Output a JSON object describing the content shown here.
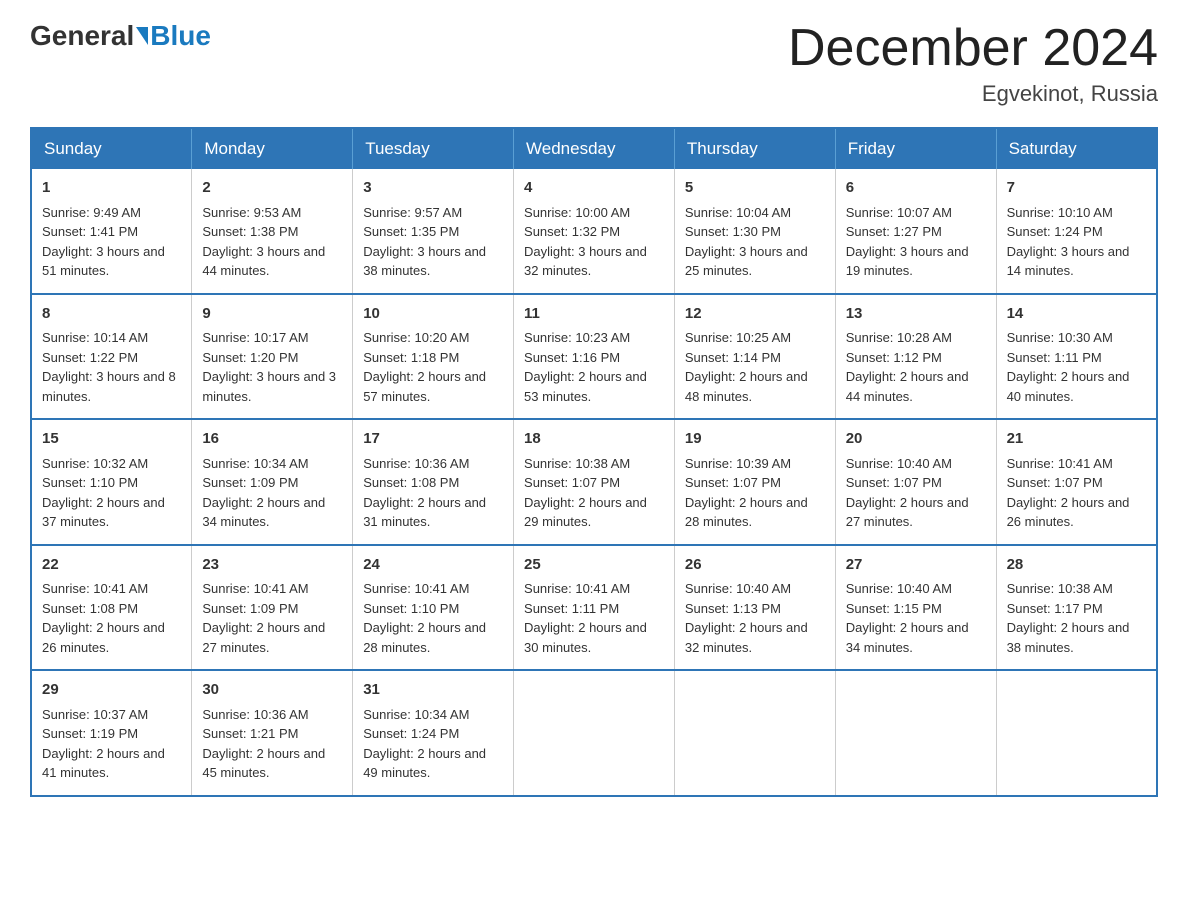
{
  "header": {
    "logo_general": "General",
    "logo_blue": "Blue",
    "month_title": "December 2024",
    "location": "Egvekinot, Russia"
  },
  "weekdays": [
    "Sunday",
    "Monday",
    "Tuesday",
    "Wednesday",
    "Thursday",
    "Friday",
    "Saturday"
  ],
  "weeks": [
    [
      {
        "day": "1",
        "sunrise": "Sunrise: 9:49 AM",
        "sunset": "Sunset: 1:41 PM",
        "daylight": "Daylight: 3 hours and 51 minutes."
      },
      {
        "day": "2",
        "sunrise": "Sunrise: 9:53 AM",
        "sunset": "Sunset: 1:38 PM",
        "daylight": "Daylight: 3 hours and 44 minutes."
      },
      {
        "day": "3",
        "sunrise": "Sunrise: 9:57 AM",
        "sunset": "Sunset: 1:35 PM",
        "daylight": "Daylight: 3 hours and 38 minutes."
      },
      {
        "day": "4",
        "sunrise": "Sunrise: 10:00 AM",
        "sunset": "Sunset: 1:32 PM",
        "daylight": "Daylight: 3 hours and 32 minutes."
      },
      {
        "day": "5",
        "sunrise": "Sunrise: 10:04 AM",
        "sunset": "Sunset: 1:30 PM",
        "daylight": "Daylight: 3 hours and 25 minutes."
      },
      {
        "day": "6",
        "sunrise": "Sunrise: 10:07 AM",
        "sunset": "Sunset: 1:27 PM",
        "daylight": "Daylight: 3 hours and 19 minutes."
      },
      {
        "day": "7",
        "sunrise": "Sunrise: 10:10 AM",
        "sunset": "Sunset: 1:24 PM",
        "daylight": "Daylight: 3 hours and 14 minutes."
      }
    ],
    [
      {
        "day": "8",
        "sunrise": "Sunrise: 10:14 AM",
        "sunset": "Sunset: 1:22 PM",
        "daylight": "Daylight: 3 hours and 8 minutes."
      },
      {
        "day": "9",
        "sunrise": "Sunrise: 10:17 AM",
        "sunset": "Sunset: 1:20 PM",
        "daylight": "Daylight: 3 hours and 3 minutes."
      },
      {
        "day": "10",
        "sunrise": "Sunrise: 10:20 AM",
        "sunset": "Sunset: 1:18 PM",
        "daylight": "Daylight: 2 hours and 57 minutes."
      },
      {
        "day": "11",
        "sunrise": "Sunrise: 10:23 AM",
        "sunset": "Sunset: 1:16 PM",
        "daylight": "Daylight: 2 hours and 53 minutes."
      },
      {
        "day": "12",
        "sunrise": "Sunrise: 10:25 AM",
        "sunset": "Sunset: 1:14 PM",
        "daylight": "Daylight: 2 hours and 48 minutes."
      },
      {
        "day": "13",
        "sunrise": "Sunrise: 10:28 AM",
        "sunset": "Sunset: 1:12 PM",
        "daylight": "Daylight: 2 hours and 44 minutes."
      },
      {
        "day": "14",
        "sunrise": "Sunrise: 10:30 AM",
        "sunset": "Sunset: 1:11 PM",
        "daylight": "Daylight: 2 hours and 40 minutes."
      }
    ],
    [
      {
        "day": "15",
        "sunrise": "Sunrise: 10:32 AM",
        "sunset": "Sunset: 1:10 PM",
        "daylight": "Daylight: 2 hours and 37 minutes."
      },
      {
        "day": "16",
        "sunrise": "Sunrise: 10:34 AM",
        "sunset": "Sunset: 1:09 PM",
        "daylight": "Daylight: 2 hours and 34 minutes."
      },
      {
        "day": "17",
        "sunrise": "Sunrise: 10:36 AM",
        "sunset": "Sunset: 1:08 PM",
        "daylight": "Daylight: 2 hours and 31 minutes."
      },
      {
        "day": "18",
        "sunrise": "Sunrise: 10:38 AM",
        "sunset": "Sunset: 1:07 PM",
        "daylight": "Daylight: 2 hours and 29 minutes."
      },
      {
        "day": "19",
        "sunrise": "Sunrise: 10:39 AM",
        "sunset": "Sunset: 1:07 PM",
        "daylight": "Daylight: 2 hours and 28 minutes."
      },
      {
        "day": "20",
        "sunrise": "Sunrise: 10:40 AM",
        "sunset": "Sunset: 1:07 PM",
        "daylight": "Daylight: 2 hours and 27 minutes."
      },
      {
        "day": "21",
        "sunrise": "Sunrise: 10:41 AM",
        "sunset": "Sunset: 1:07 PM",
        "daylight": "Daylight: 2 hours and 26 minutes."
      }
    ],
    [
      {
        "day": "22",
        "sunrise": "Sunrise: 10:41 AM",
        "sunset": "Sunset: 1:08 PM",
        "daylight": "Daylight: 2 hours and 26 minutes."
      },
      {
        "day": "23",
        "sunrise": "Sunrise: 10:41 AM",
        "sunset": "Sunset: 1:09 PM",
        "daylight": "Daylight: 2 hours and 27 minutes."
      },
      {
        "day": "24",
        "sunrise": "Sunrise: 10:41 AM",
        "sunset": "Sunset: 1:10 PM",
        "daylight": "Daylight: 2 hours and 28 minutes."
      },
      {
        "day": "25",
        "sunrise": "Sunrise: 10:41 AM",
        "sunset": "Sunset: 1:11 PM",
        "daylight": "Daylight: 2 hours and 30 minutes."
      },
      {
        "day": "26",
        "sunrise": "Sunrise: 10:40 AM",
        "sunset": "Sunset: 1:13 PM",
        "daylight": "Daylight: 2 hours and 32 minutes."
      },
      {
        "day": "27",
        "sunrise": "Sunrise: 10:40 AM",
        "sunset": "Sunset: 1:15 PM",
        "daylight": "Daylight: 2 hours and 34 minutes."
      },
      {
        "day": "28",
        "sunrise": "Sunrise: 10:38 AM",
        "sunset": "Sunset: 1:17 PM",
        "daylight": "Daylight: 2 hours and 38 minutes."
      }
    ],
    [
      {
        "day": "29",
        "sunrise": "Sunrise: 10:37 AM",
        "sunset": "Sunset: 1:19 PM",
        "daylight": "Daylight: 2 hours and 41 minutes."
      },
      {
        "day": "30",
        "sunrise": "Sunrise: 10:36 AM",
        "sunset": "Sunset: 1:21 PM",
        "daylight": "Daylight: 2 hours and 45 minutes."
      },
      {
        "day": "31",
        "sunrise": "Sunrise: 10:34 AM",
        "sunset": "Sunset: 1:24 PM",
        "daylight": "Daylight: 2 hours and 49 minutes."
      },
      null,
      null,
      null,
      null
    ]
  ]
}
